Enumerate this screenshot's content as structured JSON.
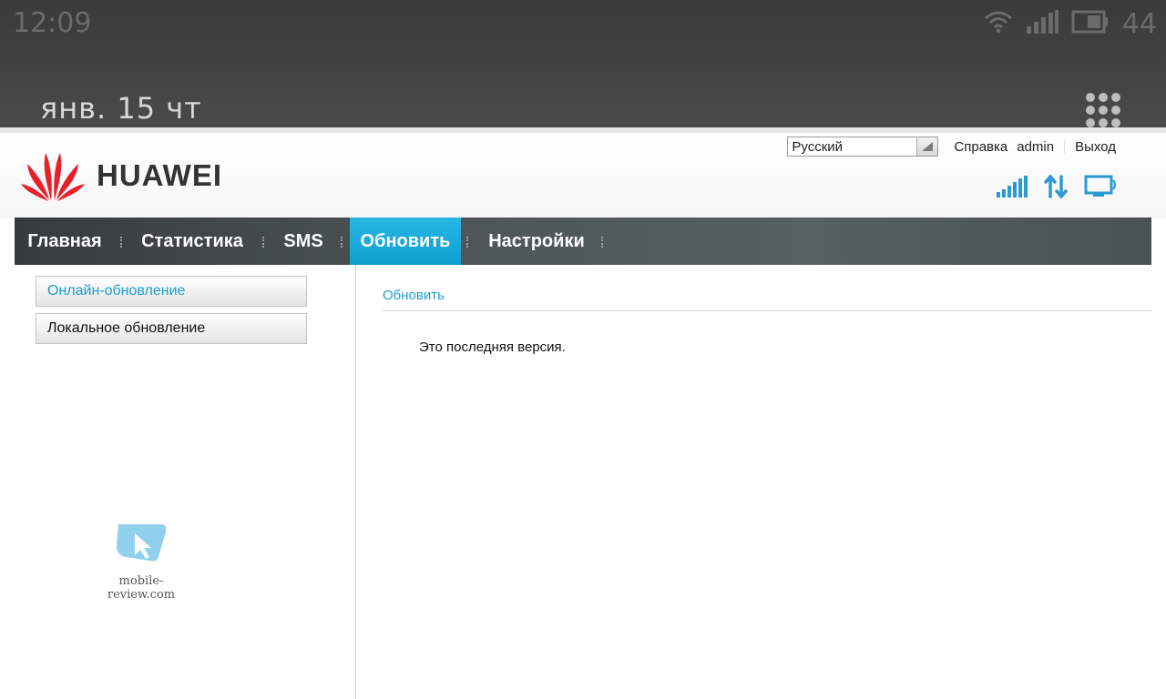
{
  "status_bar": {
    "time": "12:09",
    "date": "янв. 15 чт",
    "battery_level": "44",
    "icons": [
      "wifi-icon",
      "cell-signal-icon",
      "battery-icon"
    ]
  },
  "header": {
    "brand": "HUAWEI",
    "language": "Русский",
    "links": {
      "help": "Справка",
      "user": "admin",
      "logout": "Выход"
    },
    "status_icons": [
      "signal-strength-icon",
      "data-transfer-icon",
      "connected-device-icon"
    ],
    "accent_color": "#1aa9d8"
  },
  "nav": {
    "tabs": [
      {
        "label": "Главная",
        "active": false
      },
      {
        "label": "Статистика",
        "active": false
      },
      {
        "label": "SMS",
        "active": false
      },
      {
        "label": "Обновить",
        "active": true
      },
      {
        "label": "Настройки",
        "active": false
      }
    ]
  },
  "sidebar": {
    "items": [
      {
        "label": "Онлайн-обновление",
        "active": true
      },
      {
        "label": "Локальное обновление",
        "active": false
      }
    ]
  },
  "main": {
    "title": "Обновить",
    "message": "Это последняя версия."
  },
  "watermark": {
    "text": "mobile-review.com"
  }
}
